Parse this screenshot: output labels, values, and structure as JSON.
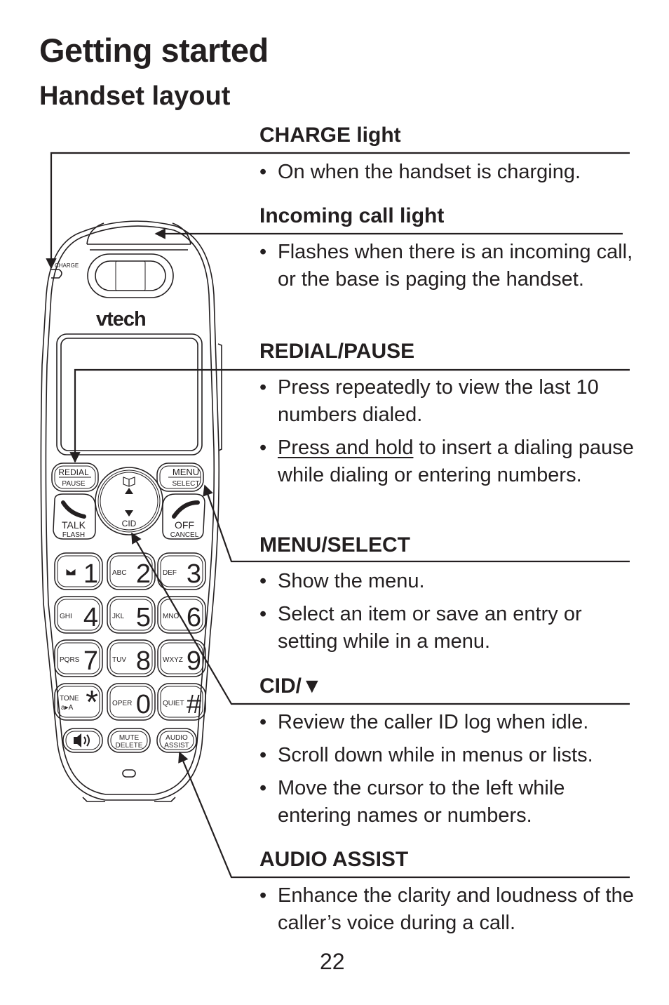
{
  "page": {
    "title": "Getting started",
    "section": "Handset layout",
    "page_number": "22"
  },
  "features": [
    {
      "heading": "CHARGE light",
      "bullets": [
        {
          "text": "On when the handset is charging."
        }
      ]
    },
    {
      "heading": "Incoming call light",
      "bullets": [
        {
          "text": "Flashes when there is an incoming call, or the base is paging the handset."
        }
      ]
    },
    {
      "heading": "REDIAL/PAUSE",
      "bullets": [
        {
          "text": "Press repeatedly to view the last 10 numbers dialed."
        },
        {
          "underline": "Press and hold",
          "text": " to insert a dialing pause while dialing or entering numbers."
        }
      ]
    },
    {
      "heading": "MENU/SELECT",
      "bullets": [
        {
          "text": "Show the menu."
        },
        {
          "text": "Select an item or save an entry or setting while in a menu."
        }
      ]
    },
    {
      "heading": "CID/▼",
      "bullets": [
        {
          "text": "Review the caller ID log when idle."
        },
        {
          "text": "Scroll down while in menus or lists."
        },
        {
          "text": "Move the cursor to the left while entering names or numbers."
        }
      ]
    },
    {
      "heading": "AUDIO ASSIST",
      "bullets": [
        {
          "text": "Enhance the clarity and loudness of the caller’s voice during a call."
        }
      ]
    }
  ],
  "handset": {
    "brand": "vtech",
    "charge_label": "CHARGE",
    "redial": {
      "top": "REDIAL",
      "bottom": "PAUSE"
    },
    "menu": {
      "top": "MENU",
      "bottom": "SELECT"
    },
    "talk": {
      "top": "TALK",
      "bottom": "FLASH"
    },
    "off": {
      "top": "OFF",
      "bottom": "CANCEL"
    },
    "nav_down_label": "CID",
    "keys": [
      {
        "digit": "1",
        "letters": "",
        "icon": "voicemail-icon"
      },
      {
        "digit": "2",
        "letters": "ABC"
      },
      {
        "digit": "3",
        "letters": "DEF"
      },
      {
        "digit": "4",
        "letters": "GHI"
      },
      {
        "digit": "5",
        "letters": "JKL"
      },
      {
        "digit": "6",
        "letters": "MNO"
      },
      {
        "digit": "7",
        "letters": "PQRS"
      },
      {
        "digit": "8",
        "letters": "TUV"
      },
      {
        "digit": "9",
        "letters": "WXYZ"
      },
      {
        "digit": "*",
        "letters": "TONE",
        "sub": "a▸A"
      },
      {
        "digit": "0",
        "letters": "OPER"
      },
      {
        "digit": "#",
        "letters": "QUIET"
      }
    ],
    "mute": {
      "top": "MUTE",
      "bottom": "DELETE"
    },
    "audio_assist": {
      "top": "AUDIO",
      "bottom": "ASSIST"
    }
  }
}
